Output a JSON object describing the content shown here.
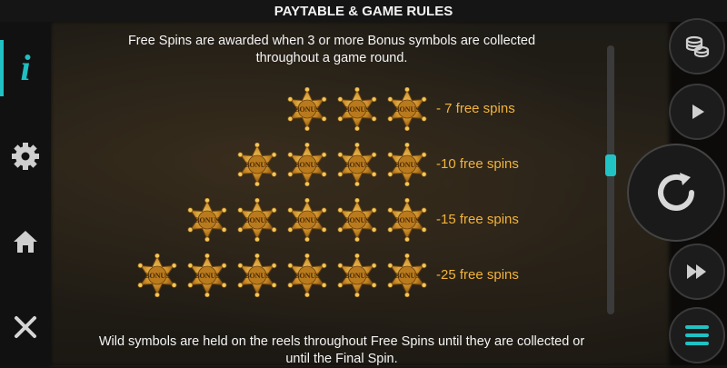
{
  "header": {
    "title": "PAYTABLE & GAME RULES"
  },
  "left_nav": {
    "items": [
      {
        "name": "info",
        "glyph": "i",
        "icon": "info-icon",
        "active": true
      },
      {
        "name": "settings",
        "icon": "gear-icon"
      },
      {
        "name": "home",
        "icon": "home-icon"
      },
      {
        "name": "close",
        "icon": "close-icon"
      }
    ]
  },
  "right_controls": [
    {
      "name": "bet",
      "icon": "coins-icon"
    },
    {
      "name": "autoplay",
      "icon": "play-icon"
    },
    {
      "name": "spin",
      "icon": "spin-icon"
    },
    {
      "name": "turbo",
      "icon": "fast-forward-icon"
    },
    {
      "name": "menu",
      "icon": "menu-icon"
    }
  ],
  "content": {
    "intro": "Free Spins are awarded when 3 or more Bonus symbols are collected throughout a game round.",
    "symbol_text": "BONUS",
    "rows": [
      {
        "count": 3,
        "label": "- 7 free spins"
      },
      {
        "count": 4,
        "label": "-10 free spins"
      },
      {
        "count": 5,
        "label": "-15 free spins"
      },
      {
        "count": 6,
        "label": "-25 free spins"
      }
    ],
    "footer": "Wild symbols are held on the reels throughout Free Spins until they are collected or until the Final Spin."
  },
  "colors": {
    "accent": "#22c1c3",
    "gold": "#f2b33b"
  }
}
